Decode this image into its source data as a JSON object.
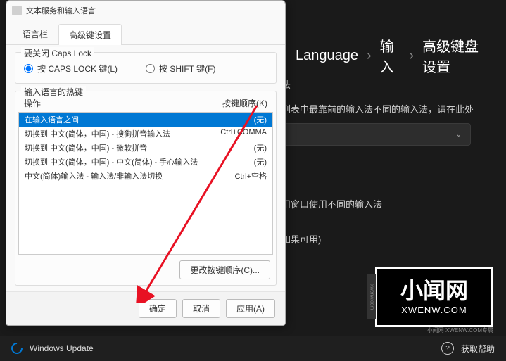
{
  "breadcrumb": {
    "lang": "Language",
    "sep": "›",
    "input": "输入",
    "adv": "高级键盘设置"
  },
  "bg": {
    "subtitle": "法",
    "line_list": "列表中最靠前的输入法不同的输入法，请在此处",
    "line_window": "用窗口使用不同的输入法",
    "line_avail": "如果可用)"
  },
  "dialog": {
    "title": "文本服务和输入语言",
    "tabs": {
      "bar": "语言栏",
      "adv": "高级键设置"
    },
    "caps_group": {
      "title": "要关闭 Caps Lock",
      "opt_caps": "按 CAPS LOCK 键(L)",
      "opt_shift": "按 SHIFT 键(F)"
    },
    "hotkey": {
      "title": "输入语言的热键",
      "col_op": "操作",
      "col_key": "按键顺序(K)",
      "rows": [
        {
          "op": "在输入语言之间",
          "key": "(无)"
        },
        {
          "op": "切换到 中文(简体，中国) - 搜狗拼音输入法",
          "key": "Ctrl+COMMA"
        },
        {
          "op": "切换到 中文(简体，中国) - 微软拼音",
          "key": "(无)"
        },
        {
          "op": "切换到 中文(简体，中国) - 中文(简体) - 手心输入法",
          "key": "(无)"
        },
        {
          "op": "中文(简体)输入法 - 输入法/非输入法切换",
          "key": "Ctrl+空格"
        }
      ],
      "change_btn": "更改按键顺序(C)..."
    },
    "buttons": {
      "ok": "确定",
      "cancel": "取消",
      "apply": "应用(A)"
    }
  },
  "taskbar": {
    "update": "Windows Update",
    "help": "获取帮助"
  },
  "watermark": {
    "cn": "小闻网",
    "en": "XWENW.COM",
    "credit": "小闻网 XWENW.COM专属"
  }
}
